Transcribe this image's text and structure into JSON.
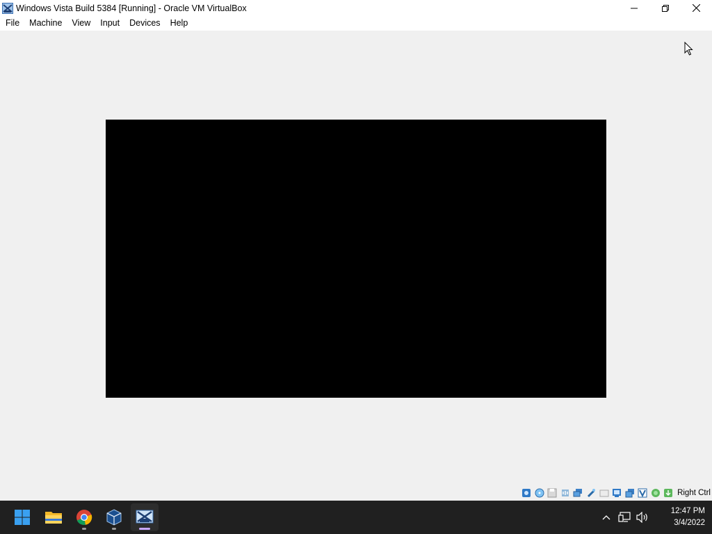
{
  "window": {
    "title": "Windows Vista Build 5384 [Running] - Oracle VM VirtualBox",
    "app_icon": "virtualbox-vista-icon",
    "controls": [
      "minimize-icon",
      "restore-icon",
      "close-icon"
    ]
  },
  "menubar": {
    "items": [
      "File",
      "Machine",
      "View",
      "Input",
      "Devices",
      "Help"
    ]
  },
  "vm": {
    "screen_color": "#000000"
  },
  "statusbar": {
    "icons": [
      "hard-disk-icon",
      "optical-drive-icon",
      "floppy-icon",
      "audio-icon",
      "network-icon",
      "usb-icon",
      "shared-folders-icon",
      "display-icon",
      "recording-icon",
      "cpu-icon",
      "vt-x-icon",
      "guest-additions-icon",
      "mouse-integration-icon"
    ],
    "host_key": "Right Ctrl"
  },
  "taskbar": {
    "apps": [
      "start-icon",
      "file-explorer-icon",
      "chrome-icon",
      "virtualbox-manager-icon",
      "virtualbox-vm-icon"
    ],
    "tray_icons": [
      "chevron-up-icon",
      "network-icon",
      "volume-icon"
    ],
    "time": "12:47 PM",
    "date": "3/4/2022"
  },
  "colors": {
    "taskbar_bg": "#202020",
    "workspace_bg": "#f0f0f0",
    "active_indicator": "#c9a7ff"
  }
}
